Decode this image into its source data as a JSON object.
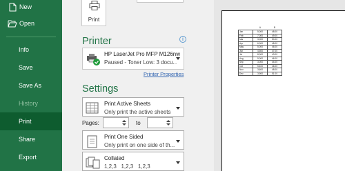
{
  "nav": {
    "items": [
      {
        "label": "New",
        "icon": "new-document-icon"
      },
      {
        "label": "Open",
        "icon": "open-folder-icon"
      },
      {
        "label": "Info"
      },
      {
        "label": "Save"
      },
      {
        "label": "Save As"
      },
      {
        "label": "History"
      },
      {
        "label": "Print"
      },
      {
        "label": "Share"
      },
      {
        "label": "Export"
      }
    ]
  },
  "print": {
    "button_label": "Print"
  },
  "printer": {
    "section_title": "Printer",
    "name": "HP LaserJet Pro MFP M126nw",
    "status": "Paused - Toner Low: 3 docu...",
    "properties_link": "Printer Properties"
  },
  "settings": {
    "section_title": "Settings",
    "what": {
      "title": "Print Active Sheets",
      "subtitle": "Only print the active sheets"
    },
    "pages_label": "Pages:",
    "to_label": "to",
    "sides": {
      "title": "Print One Sided",
      "subtitle": "Only print on one side of th..."
    },
    "collation": {
      "title": "Collated",
      "subtitle": "1,2,3   1,2,3   1,2,3"
    }
  },
  "preview": {
    "headers": [
      "A",
      "B"
    ],
    "rows": [
      [
        "Jan",
        "5,000",
        "48.00"
      ],
      [
        "Feb",
        "7,000",
        "49.00"
      ],
      [
        "Mar",
        "3,000",
        "50.00"
      ],
      [
        "Apr",
        "6,000",
        "48.00"
      ],
      [
        "May",
        "5,000",
        "46.00"
      ],
      [
        "Jun",
        "4,500",
        "47.00"
      ],
      [
        "Jul",
        "8,000",
        "43.00"
      ],
      [
        "Aug",
        "5,000",
        "46.00"
      ],
      [
        "Sep",
        "3,000",
        "44.00"
      ],
      [
        "Oct",
        "5,400",
        "46.00"
      ],
      [
        "Nov",
        "3,600",
        "48.00"
      ],
      [
        "Dec",
        "3,900",
        "51.00"
      ]
    ]
  },
  "colors": {
    "accent": "#217346",
    "selected": "#0e5c2f",
    "link": "#2e62b0"
  }
}
